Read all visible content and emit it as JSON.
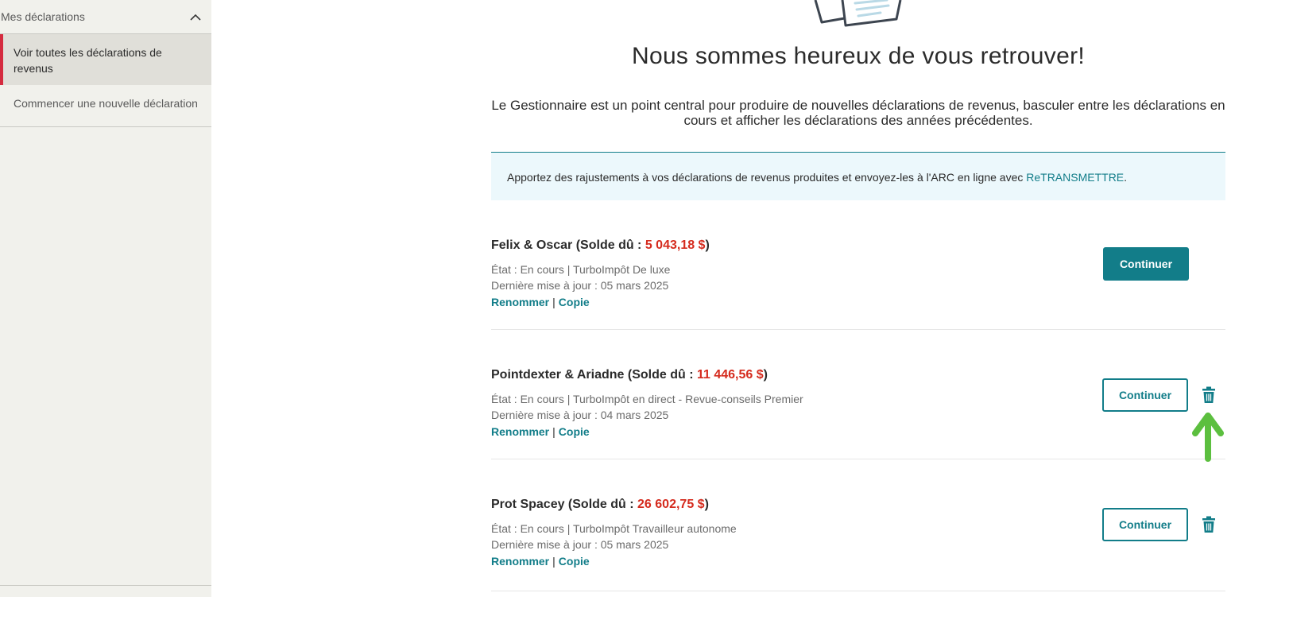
{
  "sidebar": {
    "section_label": "Mes déclarations",
    "items": [
      {
        "label": "Voir toutes les déclarations de revenus",
        "active": true
      },
      {
        "label": "Commencer une nouvelle déclaration",
        "active": false
      }
    ]
  },
  "main": {
    "title": "Nous sommes heureux de vous retrouver!",
    "intro": "Le Gestionnaire est un point central pour produire de nouvelles déclarations de revenus, basculer entre les déclarations en cours et afficher les déclarations des années précédentes.",
    "banner": {
      "text": "Apportez des rajustements à vos déclarations de revenus produites et envoyez-les à l'ARC en ligne avec ",
      "link": "ReTRANSMETTRE",
      "suffix": "."
    },
    "returns": [
      {
        "name": "Felix & Oscar",
        "balance_prefix": " (Solde dû : ",
        "balance": "5 043,18 $",
        "balance_suffix": ")",
        "status": "État : En cours | TurboImpôt De luxe",
        "updated": "Dernière mise à jour : 05 mars 2025",
        "rename": "Renommer",
        "separator": "|",
        "copy": "Copie",
        "button": "Continuer"
      },
      {
        "name": "Pointdexter & Ariadne",
        "balance_prefix": " (Solde dû : ",
        "balance": "11 446,56 $",
        "balance_suffix": ")",
        "status": "État : En cours | TurboImpôt en direct - Revue-conseils Premier",
        "updated": "Dernière mise à jour : 04 mars 2025",
        "rename": "Renommer",
        "separator": "|",
        "copy": "Copie",
        "button": "Continuer"
      },
      {
        "name": "Prot Spacey",
        "balance_prefix": " (Solde dû : ",
        "balance": "26 602,75 $",
        "balance_suffix": ")",
        "status": "État : En cours | TurboImpôt Travailleur autonome",
        "updated": "Dernière mise à jour : 05 mars 2025",
        "rename": "Renommer",
        "separator": "|",
        "copy": "Copie",
        "button": "Continuer"
      }
    ]
  },
  "icons": {
    "collapse": "chevron-up-icon",
    "delete": "trash-icon",
    "annotation": "arrow-up-icon",
    "illustration": "documents-illustration"
  },
  "colors": {
    "accent": "#127d89",
    "active_marker": "#d52b3f",
    "amount": "#d52b1e",
    "annotation_arrow": "#5cbf3f",
    "sidebar_bg": "#f1f1ec",
    "banner_bg": "#ecf8fc"
  }
}
